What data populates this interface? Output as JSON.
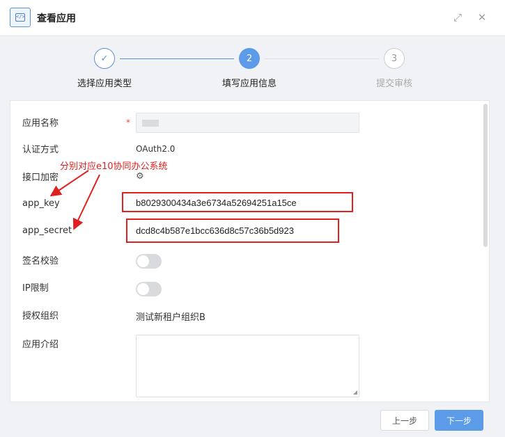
{
  "header": {
    "title": "查看应用",
    "icon": "code-window-icon",
    "icon_text": "</>"
  },
  "steps": [
    {
      "number": "✓",
      "label": "选择应用类型",
      "state": "done"
    },
    {
      "number": "2",
      "label": "填写应用信息",
      "state": "active"
    },
    {
      "number": "3",
      "label": "提交审核",
      "state": "pending"
    }
  ],
  "form": {
    "app_name": {
      "label": "应用名称",
      "required_mark": "*"
    },
    "auth": {
      "label": "认证方式",
      "value": "OAuth2.0"
    },
    "encryption": {
      "label": "接口加密"
    },
    "app_key": {
      "label": "app_key",
      "value": "b8029300434a3e6734a52694251a15ce"
    },
    "app_secret": {
      "label": "app_secret",
      "value": "dcd8c4b587e1bcc636d8c57c36b5d923"
    },
    "signature": {
      "label": "签名校验",
      "on": false
    },
    "ip_limit": {
      "label": "IP限制",
      "on": false
    },
    "org": {
      "label": "授权组织",
      "value": "测试新租户组织B"
    },
    "intro": {
      "label": "应用介绍",
      "value": ""
    }
  },
  "annotation": {
    "text": "分别对应e10协同办公系统",
    "color": "#e01f1f"
  },
  "footer": {
    "prev_label": "上一步",
    "next_label": "下一步"
  },
  "colors": {
    "accent": "#5b9be8",
    "highlight": "#e01f1f"
  }
}
